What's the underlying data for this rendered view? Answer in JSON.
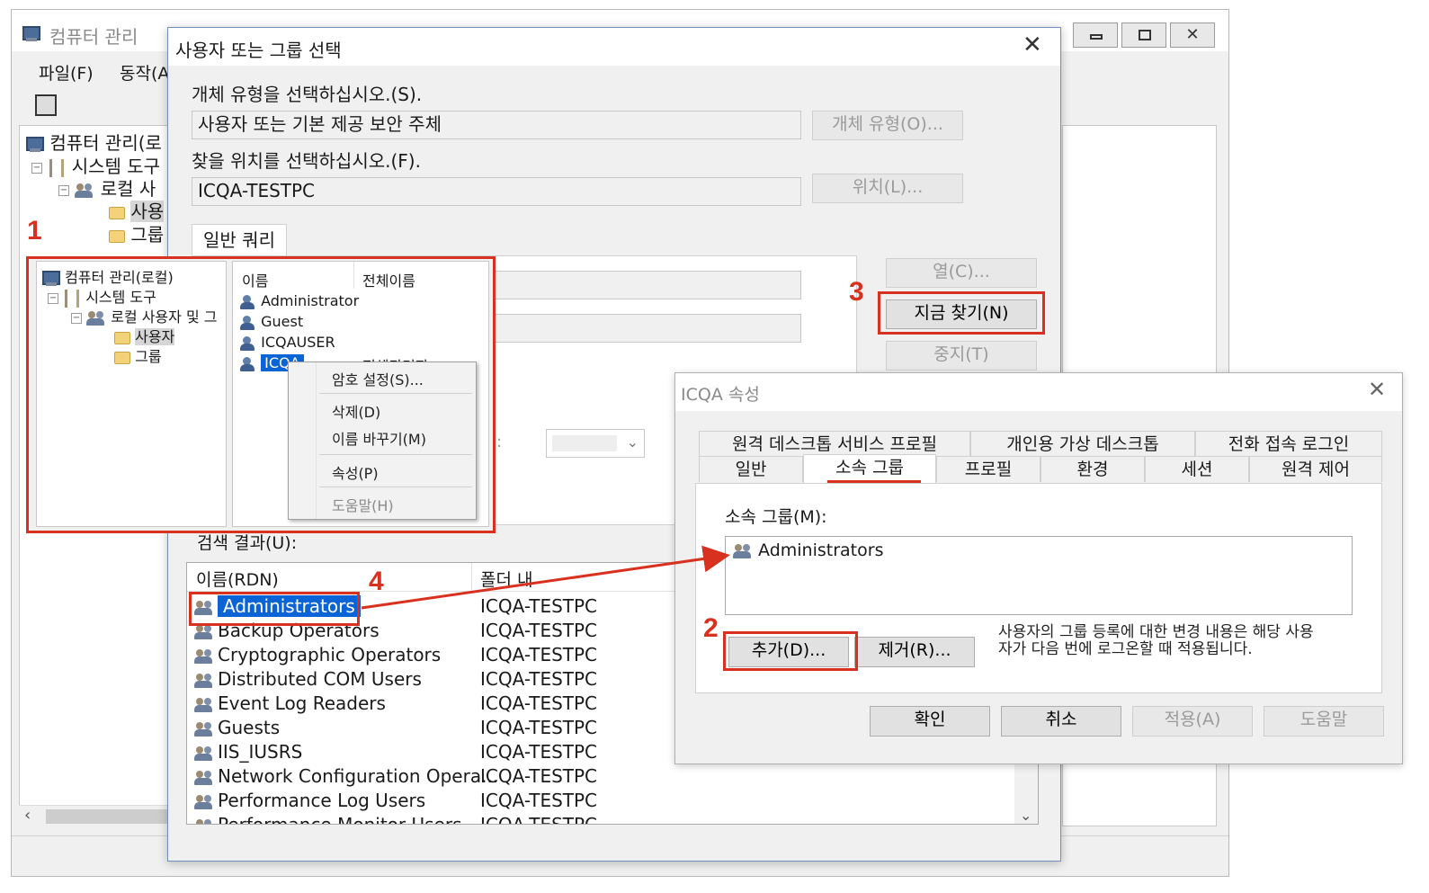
{
  "bg_window": {
    "title": "컴퓨터 관리",
    "menu": [
      "파일(F)",
      "동작(A"
    ],
    "tree": [
      {
        "label": "컴퓨터 관리(로"
      },
      {
        "label": "시스템 도구"
      },
      {
        "label": "로컬 사"
      },
      {
        "label": "사용"
      },
      {
        "label": "그룹"
      }
    ]
  },
  "select_dialog": {
    "title": "사용자 또는 그룹 선택",
    "object_type_label": "개체 유형을 선택하십시오.(S).",
    "object_type_value": "사용자 또는 기본 제공 보안 주체",
    "object_type_button": "개체 유형(O)...",
    "location_label": "찾을 위치를 선택하십시오.(F).",
    "location_value": "ICQA-TESTPC",
    "location_button": "위치(L)...",
    "query_tab": "일반 쿼리",
    "columns_button": "열(C)...",
    "find_now_button": "지금 찾기(N)",
    "stop_button": "중지(T)",
    "results_label": "검색 결과(U):",
    "results_columns": [
      "이름(RDN)",
      "폴더 내"
    ],
    "results": [
      {
        "name": "Administrators",
        "folder": "ICQA-TESTPC"
      },
      {
        "name": "Backup Operators",
        "folder": "ICQA-TESTPC"
      },
      {
        "name": "Cryptographic Operators",
        "folder": "ICQA-TESTPC"
      },
      {
        "name": "Distributed COM Users",
        "folder": "ICQA-TESTPC"
      },
      {
        "name": "Event Log Readers",
        "folder": "ICQA-TESTPC"
      },
      {
        "name": "Guests",
        "folder": "ICQA-TESTPC"
      },
      {
        "name": "IIS_IUSRS",
        "folder": "ICQA-TESTPC"
      },
      {
        "name": "Network Configuration Opera...",
        "folder": "ICQA-TESTPC"
      },
      {
        "name": "Performance Log Users",
        "folder": "ICQA-TESTPC"
      },
      {
        "name": "Performance Monitor Users",
        "folder": "ICQA-TESTPC"
      }
    ],
    "partial_dropdown_label": "):"
  },
  "inset": {
    "tree": [
      {
        "label": "컴퓨터 관리(로컬)"
      },
      {
        "label": "시스템 도구"
      },
      {
        "label": "로컬 사용자 및 그"
      },
      {
        "label": "사용자"
      },
      {
        "label": "그룹"
      }
    ],
    "columns": [
      "이름",
      "전체이름"
    ],
    "users": [
      {
        "name": "Administrator",
        "full": ""
      },
      {
        "name": "Guest",
        "full": ""
      },
      {
        "name": "ICQAUSER",
        "full": ""
      },
      {
        "name": "ICQA",
        "full": "전체관리자"
      }
    ],
    "context_menu": [
      "암호 설정(S)...",
      "삭제(D)",
      "이름 바꾸기(M)",
      "속성(P)",
      "도움말(H)"
    ]
  },
  "props_dialog": {
    "title": "ICQA 속성",
    "tabs_row1": [
      "원격 데스크톱 서비스 프로필",
      "개인용 가상 데스크톱",
      "전화 접속 로그인"
    ],
    "tabs_row2": [
      "일반",
      "소속 그룹",
      "프로필",
      "환경",
      "세션",
      "원격 제어"
    ],
    "member_of_label": "소속 그룹(M):",
    "member_of_items": [
      "Administrators"
    ],
    "add_button": "추가(D)...",
    "remove_button": "제거(R)...",
    "note": "사용자의 그룹 등록에 대한 변경 내용은 해당 사용자가 다음 번에 로그온할 때 적용됩니다.",
    "ok_button": "확인",
    "cancel_button": "취소",
    "apply_button": "적용(A)",
    "help_button": "도움말"
  },
  "annotations": [
    "1",
    "2",
    "3",
    "4"
  ],
  "colors": {
    "annotation_red": "#d9311f",
    "selection_blue": "#0a64d6"
  }
}
